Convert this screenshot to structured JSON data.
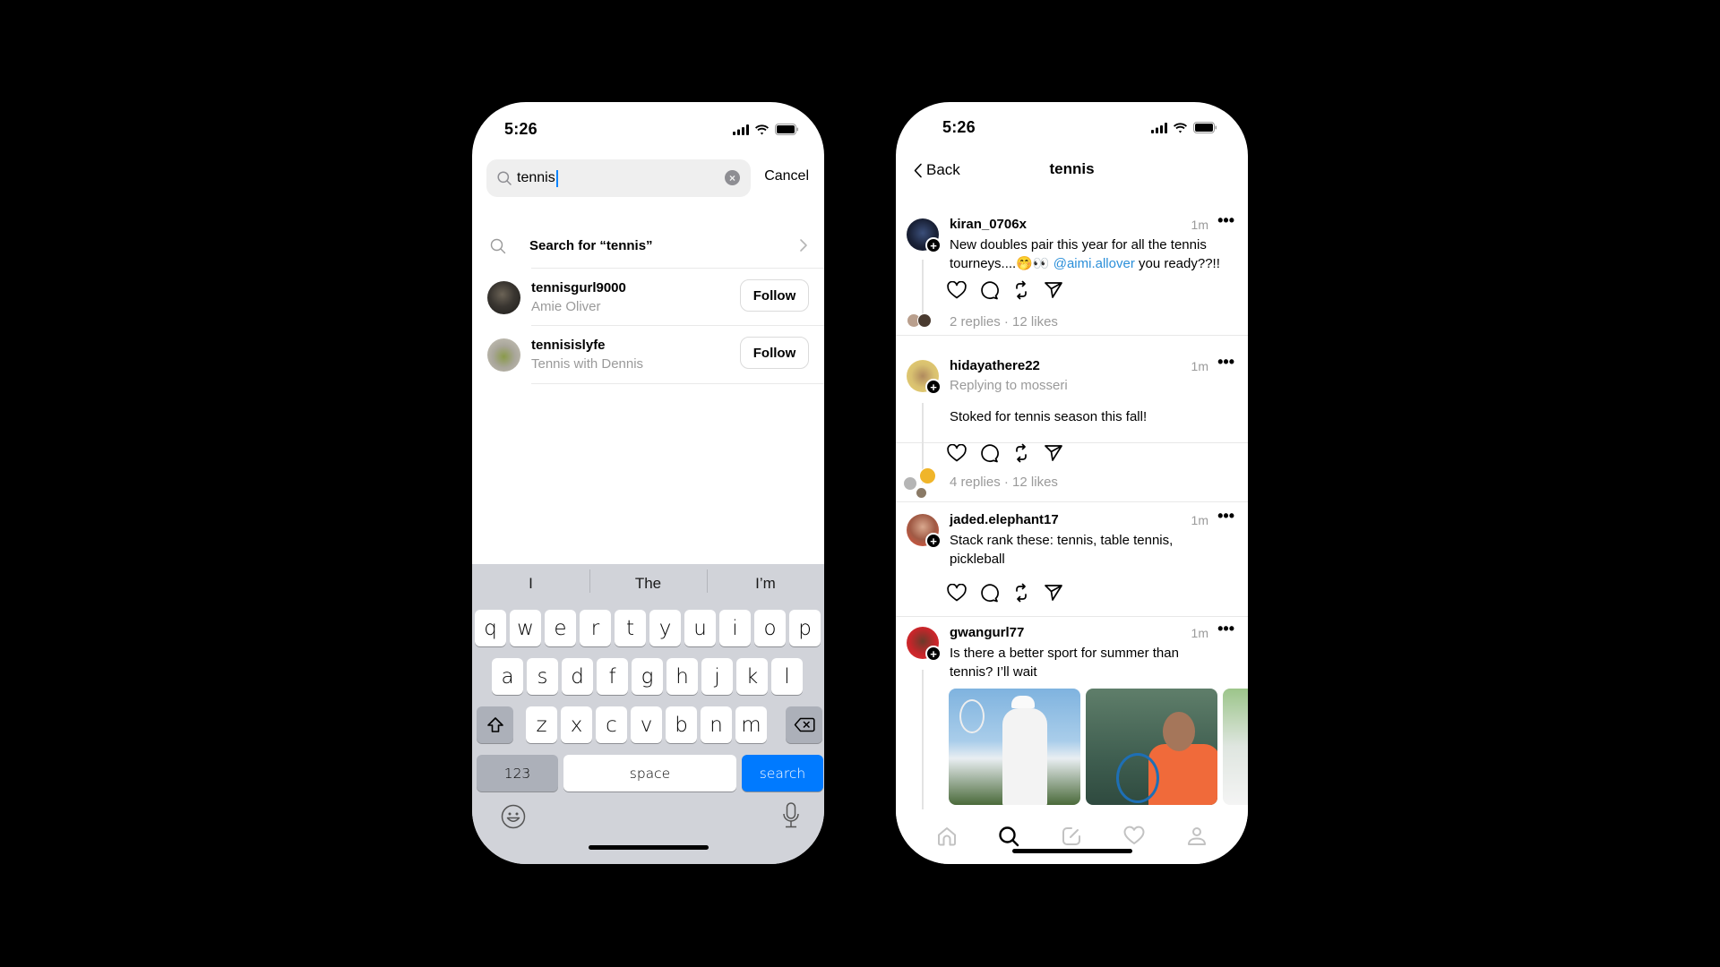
{
  "search_screen": {
    "status_time": "5:26",
    "search": {
      "value": "tennis",
      "clear_icon": "clear-circle-icon",
      "search_icon": "search-icon"
    },
    "cancel_label": "Cancel",
    "search_for_label": "Search for “tennis”",
    "users": [
      {
        "handle": "tennisgurl9000",
        "name": "Amie Oliver",
        "follow_label": "Follow"
      },
      {
        "handle": "tennisislyfe",
        "name": "Tennis with Dennis",
        "follow_label": "Follow"
      }
    ],
    "keyboard": {
      "suggestions": [
        "I",
        "The",
        "I’m"
      ],
      "row1": [
        "q",
        "w",
        "e",
        "r",
        "t",
        "y",
        "u",
        "i",
        "o",
        "p"
      ],
      "row2": [
        "a",
        "s",
        "d",
        "f",
        "g",
        "h",
        "j",
        "k",
        "l"
      ],
      "row3": [
        "z",
        "x",
        "c",
        "v",
        "b",
        "n",
        "m"
      ],
      "numbers_label": "123",
      "space_label": "space",
      "search_label": "search"
    }
  },
  "results_screen": {
    "status_time": "5:26",
    "back_label": "Back",
    "title": "tennis",
    "posts": [
      {
        "username": "kiran_0706x",
        "time": "1m",
        "text_before": "New doubles pair this year for all the tennis tourneys....🤭👀 ",
        "mention": "@aimi.allover",
        "text_after": " you ready??!!",
        "replies": "2 replies",
        "likes": "12 likes"
      },
      {
        "username": "hidayathere22",
        "time": "1m",
        "replying_to": "Replying to mosseri",
        "text": "Stoked for tennis season this fall!",
        "replies": "4 replies",
        "likes": "12 likes"
      },
      {
        "username": "jaded.elephant17",
        "time": "1m",
        "text": "Stack rank these: tennis, table tennis, pickleball"
      },
      {
        "username": "gwangurl77",
        "time": "1m",
        "text": "Is there a better sport for summer than tennis? I’ll wait"
      }
    ],
    "stats_separator": "·",
    "more_label": "•••",
    "tabbar": [
      "home-icon",
      "search-icon",
      "compose-icon",
      "heart-icon",
      "profile-icon"
    ],
    "active_tab": "search-icon"
  },
  "colors": {
    "accent_blue": "#007aff",
    "mention_blue": "#2b8fd9",
    "keyboard_bg": "#d1d3d9",
    "muted_text": "#9a9a9a"
  }
}
